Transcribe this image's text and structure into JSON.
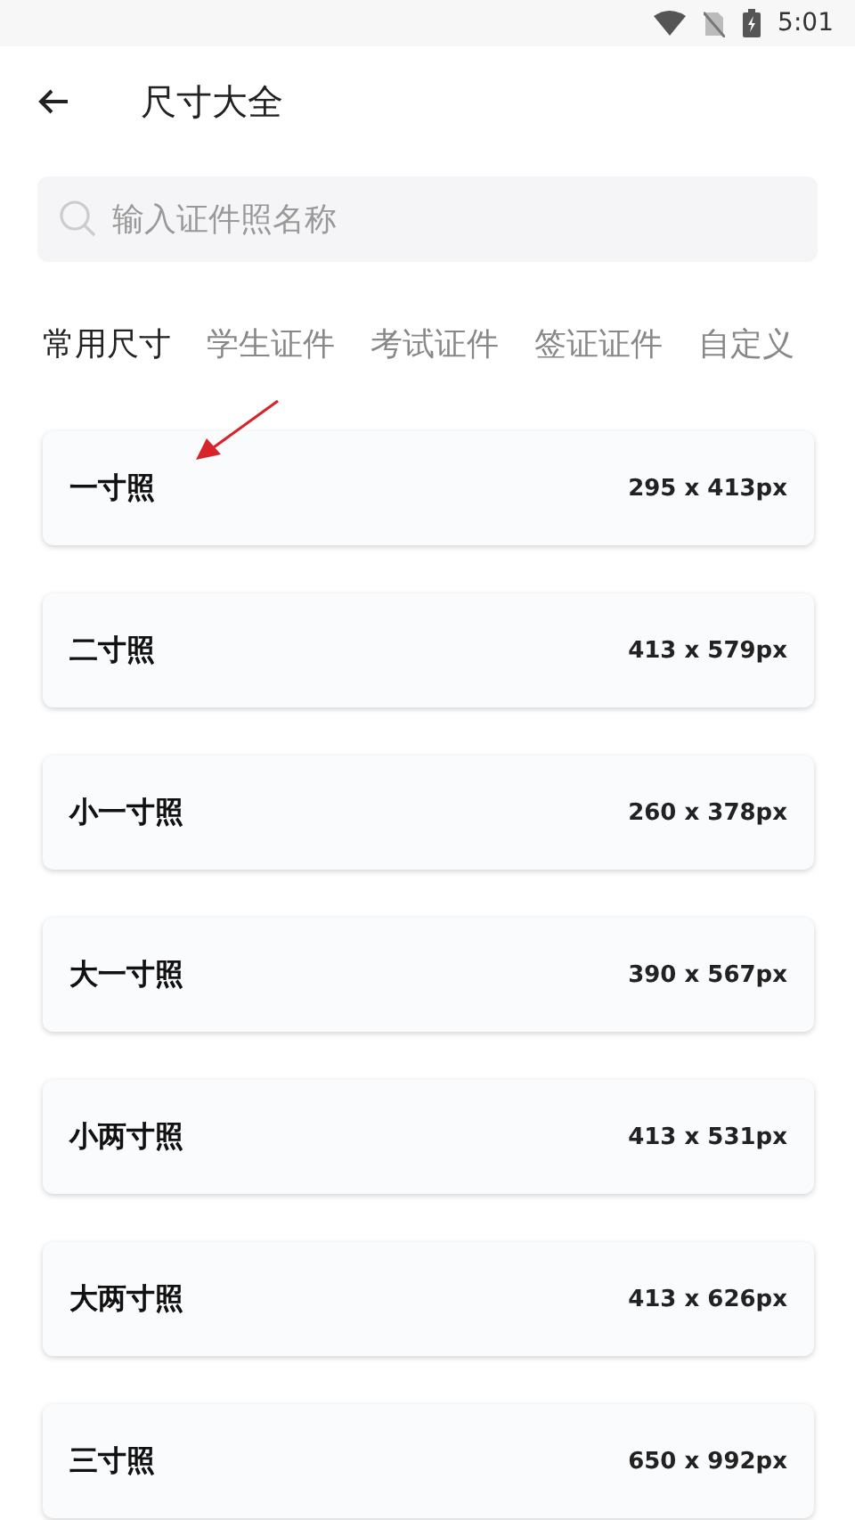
{
  "status_bar": {
    "time": "5:01"
  },
  "header": {
    "title": "尺寸大全"
  },
  "search": {
    "placeholder": "输入证件照名称"
  },
  "tabs": [
    {
      "label": "常用尺寸",
      "selected": true
    },
    {
      "label": "学生证件",
      "selected": false
    },
    {
      "label": "考试证件",
      "selected": false
    },
    {
      "label": "签证证件",
      "selected": false
    },
    {
      "label": "自定义",
      "selected": false
    }
  ],
  "sizes": [
    {
      "name": "一寸照",
      "pixels": "295 x 413px"
    },
    {
      "name": "二寸照",
      "pixels": "413 x 579px"
    },
    {
      "name": "小一寸照",
      "pixels": "260 x 378px"
    },
    {
      "name": "大一寸照",
      "pixels": "390 x 567px"
    },
    {
      "name": "小两寸照",
      "pixels": "413 x 531px"
    },
    {
      "name": "大两寸照",
      "pixels": "413 x 626px"
    },
    {
      "name": "三寸照",
      "pixels": "650 x 992px"
    }
  ]
}
